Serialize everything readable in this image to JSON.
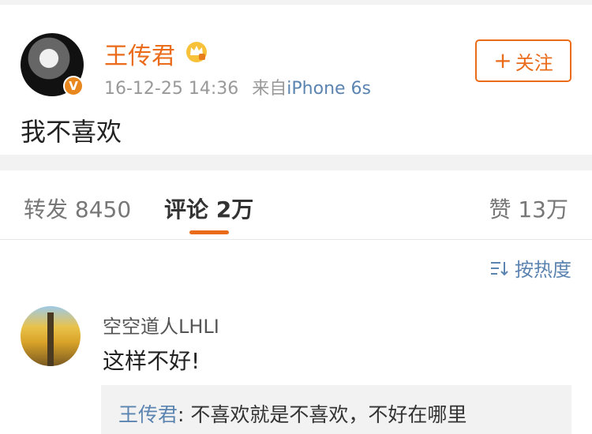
{
  "post": {
    "username": "王传君",
    "verified_badge": "V",
    "date": "16-12-25 14:36",
    "source_prefix": "来自",
    "source": "iPhone 6s",
    "follow_label": "关注",
    "follow_plus": "+",
    "content": "我不喜欢",
    "icons": [
      "crown-vip-icon",
      "verified-v-icon",
      "plus-icon"
    ]
  },
  "tabs": {
    "repost": "转发 8450",
    "comment": "评论 2万",
    "like": "赞 13万"
  },
  "sort": {
    "label": "按热度",
    "icon": "sort-icon"
  },
  "comment": {
    "username": "空空道人LHLI",
    "text": "这样不好!",
    "reply_user": "王传君",
    "reply_sep": ": ",
    "reply_text": "不喜欢就是不喜欢，不好在哪里"
  },
  "colors": {
    "accent": "#ea6b1a",
    "link": "#5b84b1",
    "background": "#f2f2f2"
  }
}
